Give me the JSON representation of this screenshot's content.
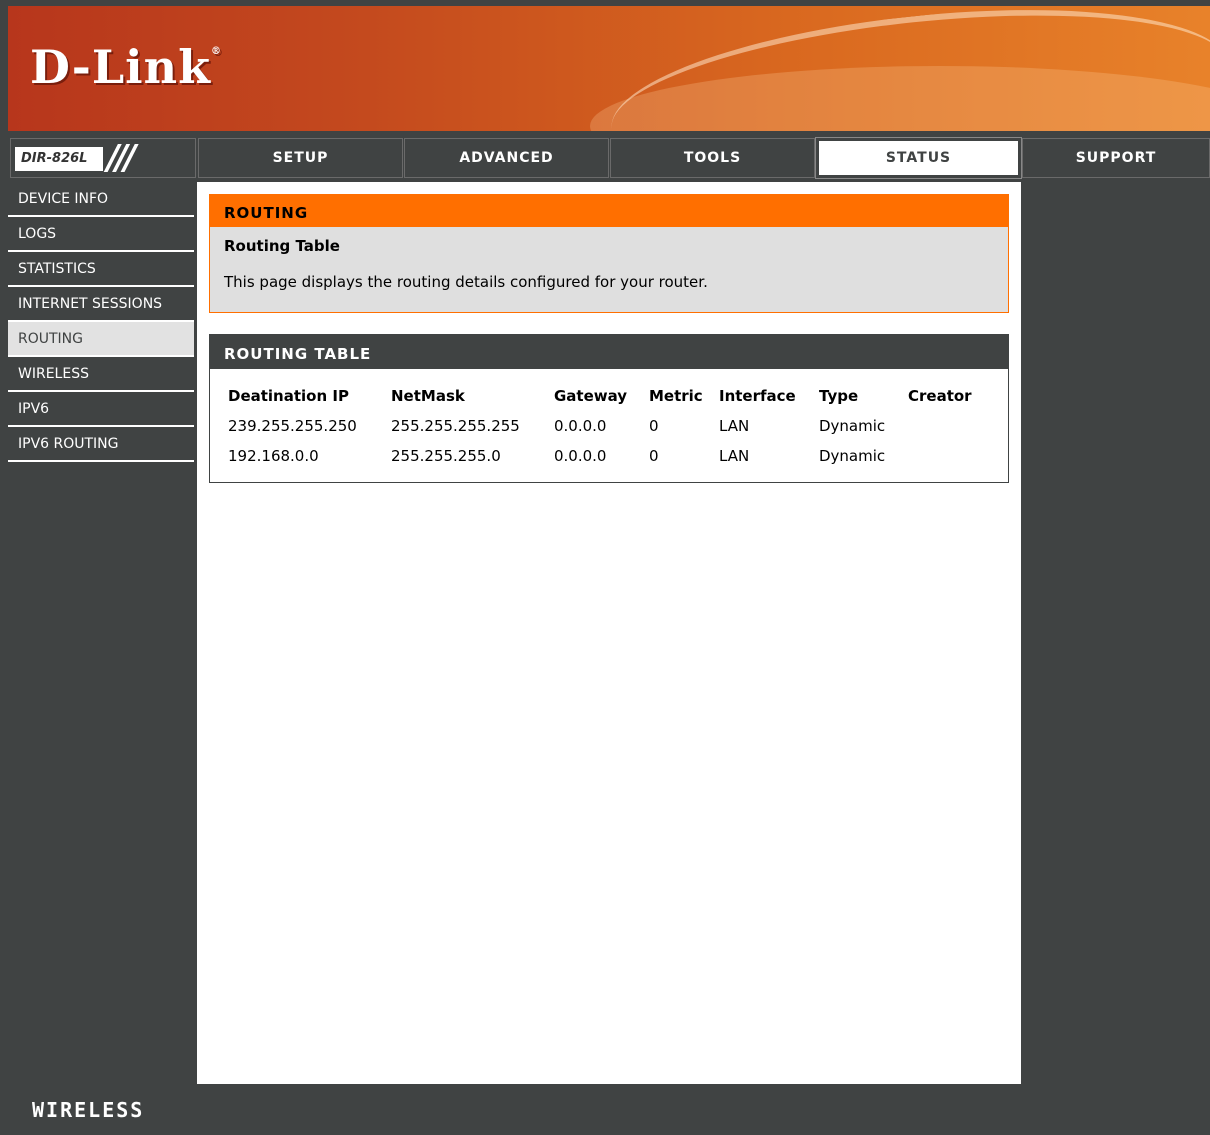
{
  "brand": {
    "logo": "D-Link",
    "footer": "WIRELESS"
  },
  "model": {
    "label": "DIR-826L",
    "slashes": "///"
  },
  "tabs": [
    {
      "label": "SETUP",
      "active": false
    },
    {
      "label": "ADVANCED",
      "active": false
    },
    {
      "label": "TOOLS",
      "active": false
    },
    {
      "label": "STATUS",
      "active": true
    },
    {
      "label": "SUPPORT",
      "active": false
    }
  ],
  "sidebar": {
    "items": [
      {
        "label": "DEVICE INFO",
        "active": false
      },
      {
        "label": "LOGS",
        "active": false
      },
      {
        "label": "STATISTICS",
        "active": false
      },
      {
        "label": "INTERNET SESSIONS",
        "active": false
      },
      {
        "label": "ROUTING",
        "active": true
      },
      {
        "label": "WIRELESS",
        "active": false
      },
      {
        "label": "IPV6",
        "active": false
      },
      {
        "label": "IPV6 ROUTING",
        "active": false
      }
    ]
  },
  "routing": {
    "header": "ROUTING",
    "subtitle": "Routing Table",
    "description": "This page displays the routing details configured for your router."
  },
  "routing_table": {
    "header": "ROUTING TABLE",
    "columns": [
      "Deatination IP",
      "NetMask",
      "Gateway",
      "Metric",
      "Interface",
      "Type",
      "Creator"
    ],
    "rows": [
      [
        "239.255.255.250",
        "255.255.255.255",
        "0.0.0.0",
        "0",
        "LAN",
        "Dynamic",
        ""
      ],
      [
        "192.168.0.0",
        "255.255.255.0",
        "0.0.0.0",
        "0",
        "LAN",
        "Dynamic",
        ""
      ]
    ]
  },
  "colors": {
    "accent": "#ff6f00",
    "dark": "#404343",
    "panel": "#dfdfdf"
  }
}
